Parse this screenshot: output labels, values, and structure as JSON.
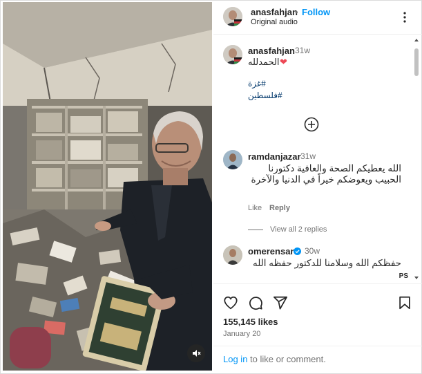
{
  "post": {
    "username": "anasfahjan",
    "follow_label": "Follow",
    "separator": "•",
    "audio": "Original audio"
  },
  "caption": {
    "username": "anasfahjan",
    "time": "31w",
    "text": "الحمدلله",
    "emoji": "❤",
    "hashtags": [
      "#غزة",
      "#فلسطين"
    ]
  },
  "comments": [
    {
      "username": "ramdanjazar",
      "time": "31w",
      "text": "الله يعطيكم الصحة والعافية دكتورنا الحبيب ويعوضكم خيراً في الدنيا والآخرة",
      "like_label": "Like",
      "reply_label": "Reply",
      "view_replies": "View all 2 replies"
    },
    {
      "username": "omerensar",
      "verified": true,
      "time": "30w",
      "text": "حفظكم الله وسلامنا للدكتور حفظه الله",
      "tag": "PS"
    }
  ],
  "stats": {
    "likes": "155,145 likes",
    "date": "January 20"
  },
  "footer": {
    "login_link": "Log in",
    "login_rest": " to like or comment."
  },
  "icons": {
    "more": "more-horizontal-icon",
    "add": "plus-circle-icon",
    "like": "heart-icon",
    "comment": "comment-icon",
    "share": "share-icon",
    "save": "bookmark-icon",
    "mute": "muted-speaker-icon"
  },
  "colors": {
    "accent": "#0095f6",
    "link": "#00376b",
    "muted": "#737373",
    "heart": "#ed4956",
    "verified": "#0095f6"
  }
}
